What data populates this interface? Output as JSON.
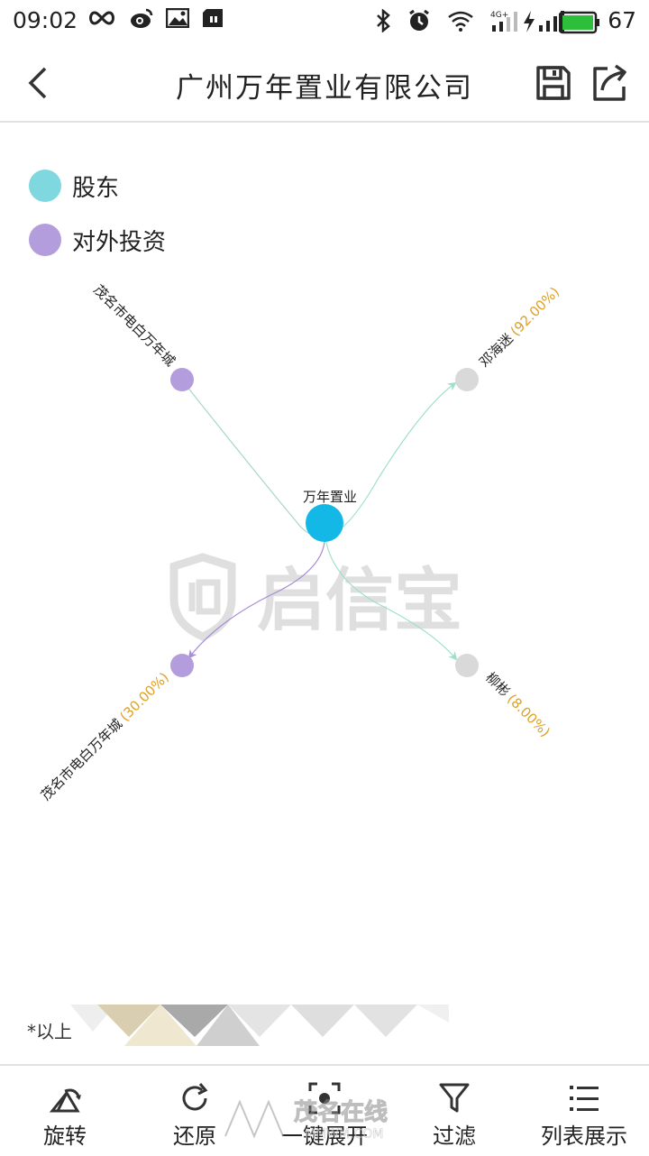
{
  "status_bar": {
    "time": "09:02",
    "battery_level": "67",
    "left_icons": [
      "infinity-icon",
      "weibo-icon",
      "image-icon",
      "sim-icon"
    ],
    "right_icons": [
      "bluetooth-icon",
      "alarm-icon",
      "wifi-icon",
      "signal-4g-icon",
      "signal-icon",
      "charging-icon",
      "battery-icon"
    ],
    "network_label": "4G+"
  },
  "header": {
    "title": "广州万年置业有限公司"
  },
  "legend": {
    "items": [
      {
        "label": "股东",
        "color": "#7fd8df"
      },
      {
        "label": "对外投资",
        "color": "#b39ddd"
      }
    ]
  },
  "graph": {
    "center_label": "万年置业",
    "center_color": "#14b8e6",
    "shareholder_color": "#d9d9d9",
    "investment_color": "#b39ddd",
    "percent_color": "#e0a020",
    "nodes": [
      {
        "name": "茂名市电白万年城",
        "percent": ""
      },
      {
        "name": "邓海迷",
        "percent": "(92.00%)"
      },
      {
        "name": "茂名市电白万年城",
        "percent": "(30.00%)"
      },
      {
        "name": "柳彬",
        "percent": "(8.00%)"
      }
    ]
  },
  "watermark": {
    "text": "启信宝"
  },
  "footer_note": {
    "text": "*以上"
  },
  "bottom_nav": {
    "items": [
      {
        "label": "旋转",
        "icon": "rotate-icon"
      },
      {
        "label": "还原",
        "icon": "refresh-icon"
      },
      {
        "label": "一键展开",
        "icon": "expand-icon"
      },
      {
        "label": "过滤",
        "icon": "filter-icon"
      },
      {
        "label": "列表展示",
        "icon": "list-icon"
      }
    ]
  },
  "site_watermark": {
    "text": "茂名在线",
    "subtext": "MMWM.COM"
  }
}
